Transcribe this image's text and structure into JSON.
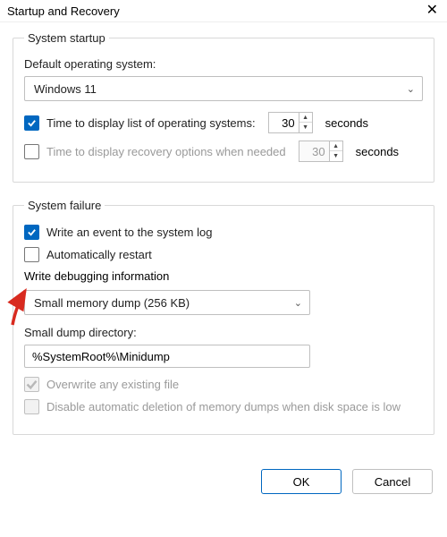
{
  "title": "Startup and Recovery",
  "groups": {
    "startup": {
      "legend": "System startup",
      "default_os_label": "Default operating system:",
      "default_os_value": "Windows 11",
      "time_os_label": "Time to display list of operating systems:",
      "time_os_value": "30",
      "time_recovery_label": "Time to display recovery options when needed",
      "time_recovery_value": "30",
      "seconds": "seconds"
    },
    "failure": {
      "legend": "System failure",
      "write_event_label": "Write an event to the system log",
      "auto_restart_label": "Automatically restart",
      "write_debug_label": "Write debugging information",
      "dump_type_value": "Small memory dump (256 KB)",
      "dump_dir_label": "Small dump directory:",
      "dump_dir_value": "%SystemRoot%\\Minidump",
      "overwrite_label": "Overwrite any existing file",
      "disable_auto_del_label": "Disable automatic deletion of memory dumps when disk space is low"
    }
  },
  "buttons": {
    "ok": "OK",
    "cancel": "Cancel"
  },
  "states": {
    "time_os_checked": true,
    "time_recovery_checked": false,
    "write_event_checked": true,
    "auto_restart_checked": false,
    "overwrite_checked": true,
    "overwrite_disabled": true,
    "disable_auto_del_checked": false,
    "disable_auto_del_disabled": true
  },
  "annotation": {
    "arrow_color": "#d82a1f"
  }
}
